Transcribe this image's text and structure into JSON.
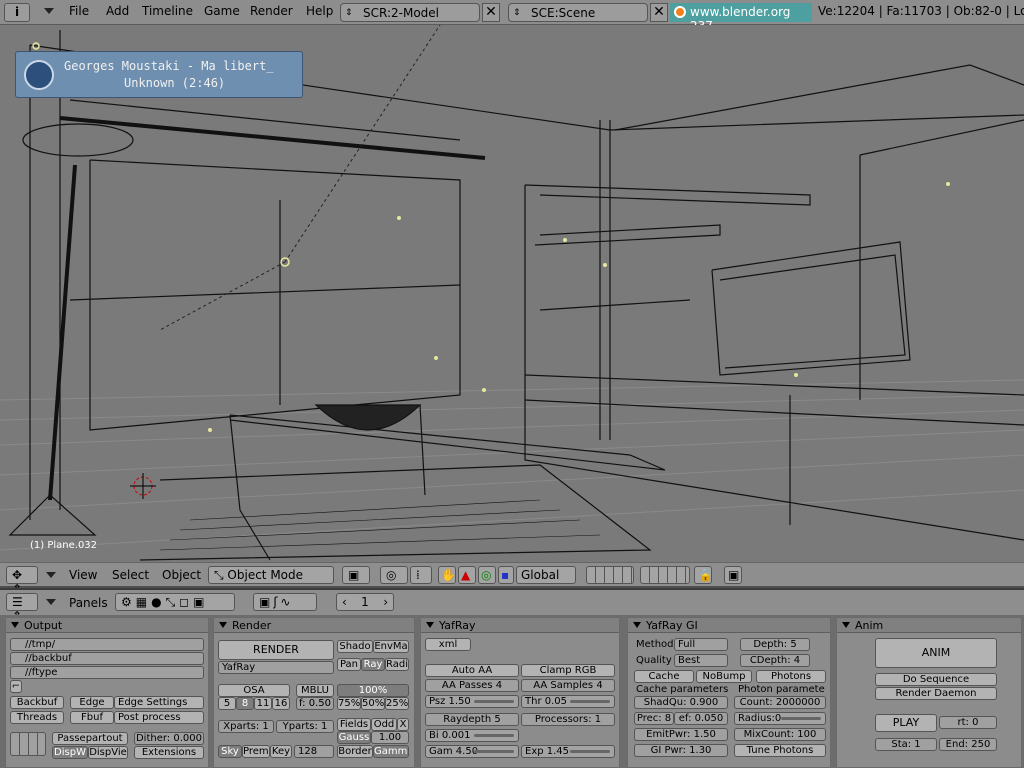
{
  "topbar": {
    "menus": [
      "File",
      "Add",
      "Timeline",
      "Game",
      "Render",
      "Help"
    ],
    "screen": "SCR:2-Model",
    "scene": "SCE:Scene",
    "url": "www.blender.org 237",
    "stats": "Ve:12204 | Fa:11703 | Ob:82-0 | Lo"
  },
  "music": {
    "line1": "Georges Moustaki - Ma libert_",
    "line2": "Unknown (2:46)"
  },
  "viewport": {
    "object_label": "(1) Plane.032"
  },
  "view3d_header": {
    "menus": [
      "View",
      "Select",
      "Object"
    ],
    "mode": "Object Mode",
    "orientation": "Global"
  },
  "buttons_header": {
    "panels_label": "Panels",
    "frame": "1"
  },
  "output": {
    "title": "Output",
    "paths": [
      "//tmp/",
      "//backbuf",
      "//ftype"
    ],
    "backbuf": "Backbuf",
    "edge": "Edge",
    "edge_settings": "Edge Settings",
    "threads": "Threads",
    "fbuf": "Fbuf",
    "post_process": "Post process",
    "passepartout": "Passepartout",
    "dither": "Dither: 0.000",
    "dispw": "DispW",
    "dispview": "DispVie",
    "extensions": "Extensions"
  },
  "render": {
    "title": "Render",
    "render_btn": "RENDER",
    "renderer": "YafRay",
    "shadow": "Shado",
    "envmap": "EnvMa",
    "pano": "Pan",
    "ray": "Ray",
    "radio": "Radi",
    "osa": "OSA",
    "mblur": "MBLU",
    "osa_levels": [
      "5",
      "8",
      "11",
      "16"
    ],
    "mblur_f": "f: 0.50",
    "size_pct": "100%",
    "sizes": [
      "75%",
      "50%",
      "25%"
    ],
    "xparts": "Xparts: 1",
    "yparts": "Yparts: 1",
    "fields": "Fields",
    "odd": "Odd",
    "x": "X",
    "gauss": "Gauss",
    "gauss_val": "1.00",
    "sky": "Sky",
    "premul": "Premu",
    "key": "Key",
    "bits": "128",
    "border": "Border",
    "gamma": "Gamma"
  },
  "yafray": {
    "title": "YafRay",
    "xml": "xml",
    "auto_aa": "Auto AA",
    "clamp_rgb": "Clamp RGB",
    "aa_passes": "AA Passes 4",
    "aa_samples": "AA Samples 4",
    "psz": "Psz 1.50",
    "thr": "Thr 0.05",
    "raydepth": "Raydepth 5",
    "processors": "Processors: 1",
    "bi": "Bi 0.001",
    "gam": "Gam 4.50",
    "exp": "Exp 1.45"
  },
  "yafray_gi": {
    "title": "YafRay GI",
    "method_lbl": "Method",
    "method": "Full",
    "depth": "Depth: 5",
    "quality_lbl": "Quality",
    "quality": "Best",
    "cdepth": "CDepth: 4",
    "cache": "Cache",
    "nobump": "NoBump",
    "photons": "Photons",
    "cache_params": "Cache parameters",
    "photon_params": "Photon paramete",
    "shadqu": "ShadQu: 0.900",
    "count": "Count: 2000000",
    "prec": "Prec: 8",
    "ref": "ef: 0.050",
    "radius": "Radius:0",
    "emitpwr": "EmitPwr: 1.50",
    "mixcount": "MixCount: 100",
    "gipwr": "GI Pwr: 1.30",
    "tune": "Tune Photons"
  },
  "anim": {
    "title": "Anim",
    "anim_btn": "ANIM",
    "do_seq": "Do Sequence",
    "daemon": "Render Daemon",
    "play": "PLAY",
    "rt": "rt: 0",
    "sta": "Sta: 1",
    "end": "End: 250"
  },
  "colors": {
    "url_bg": "#4ea0a0",
    "url_fg": "#ffffff",
    "music_bg": "#6f8fb0"
  }
}
